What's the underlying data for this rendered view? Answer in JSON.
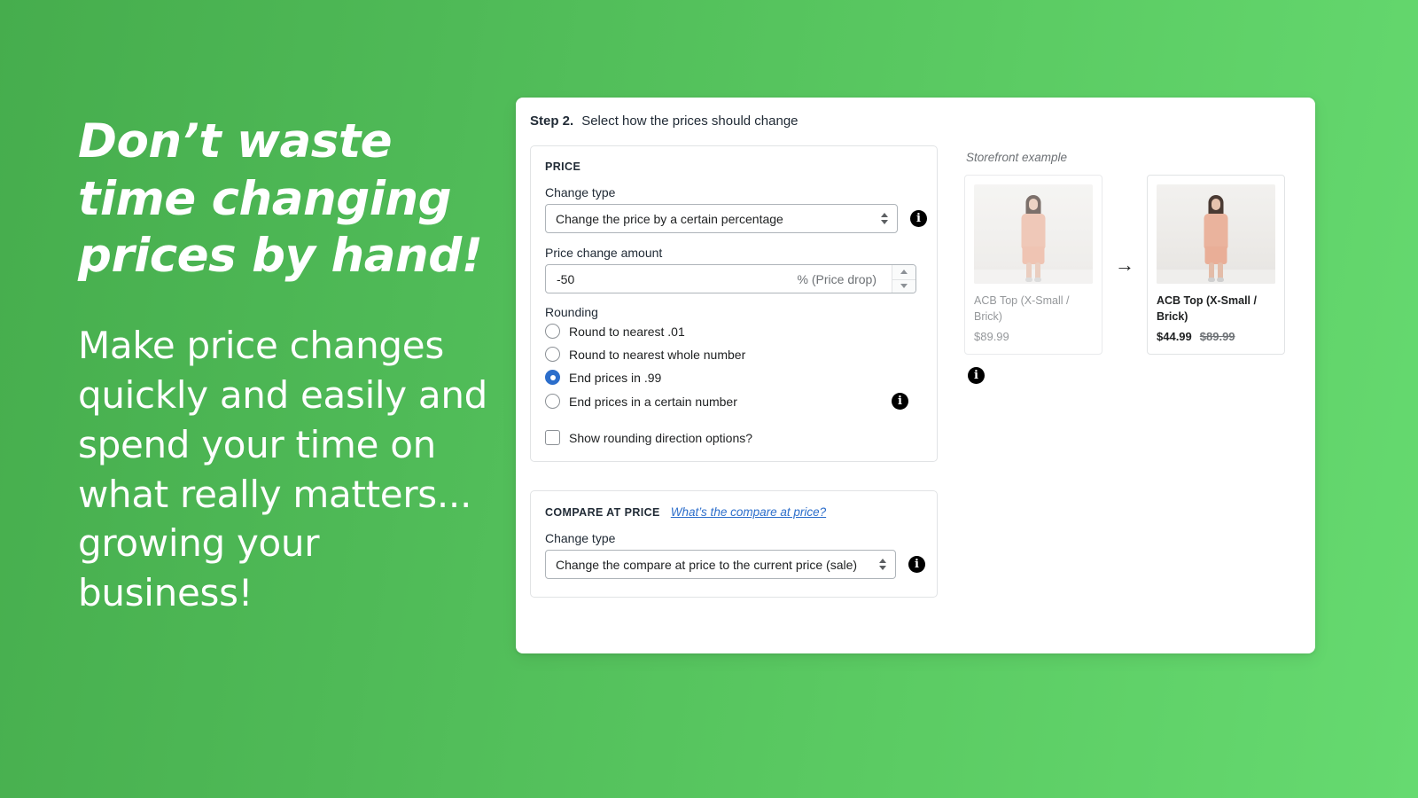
{
  "promo": {
    "headline": "Don’t waste time changing prices by hand!",
    "body": "Make price changes quickly and easily and spend your time on what really matters... growing your business!"
  },
  "panel": {
    "step_label": "Step 2.",
    "step_description": "Select how the prices should change",
    "price_card": {
      "title": "PRICE",
      "change_type_label": "Change type",
      "change_type_value": "Change the price by a certain percentage",
      "amount_label": "Price change amount",
      "amount_value": "-50",
      "amount_suffix": "% (Price drop)",
      "rounding_label": "Rounding",
      "rounding_options": [
        {
          "label": "Round to nearest .01",
          "checked": false
        },
        {
          "label": "Round to nearest whole number",
          "checked": false
        },
        {
          "label": "End prices in .99",
          "checked": true
        },
        {
          "label": "End prices in a certain number",
          "checked": false
        }
      ],
      "show_rounding_direction_label": "Show rounding direction options?",
      "show_rounding_direction_checked": false
    },
    "compare_card": {
      "title": "COMPARE AT PRICE",
      "help_link": "What’s the compare at price?",
      "change_type_label": "Change type",
      "change_type_value": "Change the compare at price to the current price (sale)"
    },
    "storefront": {
      "caption": "Storefront example",
      "arrow": "→",
      "before": {
        "name": "ACB Top (X-Small / Brick)",
        "price": "$89.99"
      },
      "after": {
        "name": "ACB Top (X-Small / Brick)",
        "price_new": "$44.99",
        "price_old": "$89.99"
      }
    },
    "info_icon_glyph": "i"
  },
  "colors": {
    "background_start": "#46ad4d",
    "background_end": "#66da70",
    "accent_blue": "#2c6ecb",
    "text_primary": "#202223",
    "text_subdued": "#6d7175",
    "border": "#e1e3e5"
  }
}
